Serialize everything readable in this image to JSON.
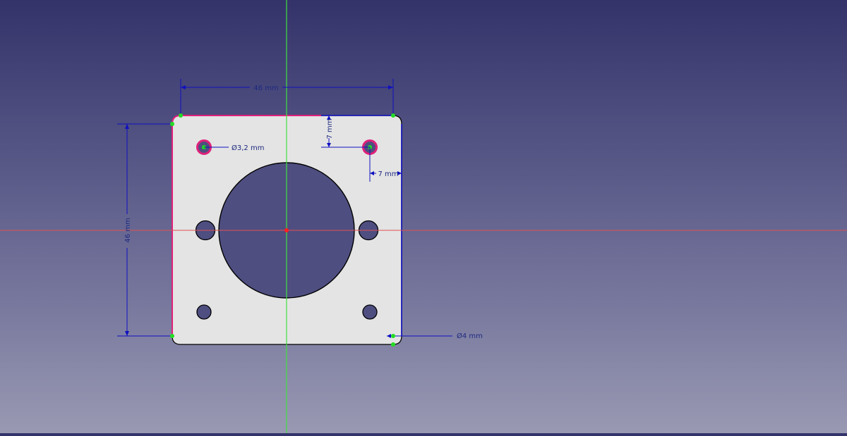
{
  "viewport": {
    "background_top": "#33336a",
    "background_bottom": "#9999b3",
    "axis_x_color": "#e05050",
    "axis_y_color": "#40e040"
  },
  "sketch": {
    "plate_fill": "#e4e4e4",
    "edge_color": "#000000",
    "constraint_color": "#1010c0",
    "selected_color": "#e0207a",
    "point_color": "#22dd22",
    "dimensions": {
      "width_top": "46 mm",
      "height_left": "46 mm",
      "hole_diameter": "Ø3,2 mm",
      "offset_vertical": "7 mm",
      "offset_horizontal": "7 mm",
      "corner_radius_diameter": "Ø4 mm"
    }
  }
}
